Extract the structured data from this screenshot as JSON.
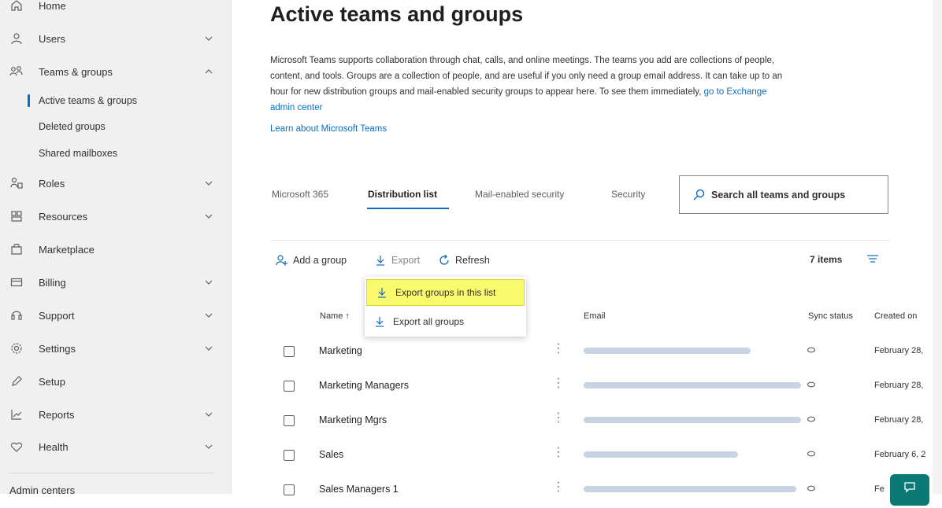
{
  "sidebar": {
    "items": [
      {
        "label": "Home",
        "icon": "home-icon",
        "chevron": false
      },
      {
        "label": "Users",
        "icon": "user-icon",
        "chevron": "down"
      },
      {
        "label": "Teams & groups",
        "icon": "teams-groups-icon",
        "chevron": "up"
      },
      {
        "label": "Roles",
        "icon": "roles-icon",
        "chevron": "down"
      },
      {
        "label": "Resources",
        "icon": "resources-icon",
        "chevron": "down"
      },
      {
        "label": "Marketplace",
        "icon": "marketplace-icon",
        "chevron": false
      },
      {
        "label": "Billing",
        "icon": "billing-icon",
        "chevron": "down"
      },
      {
        "label": "Support",
        "icon": "support-icon",
        "chevron": "down"
      },
      {
        "label": "Settings",
        "icon": "settings-icon",
        "chevron": "down"
      },
      {
        "label": "Setup",
        "icon": "setup-icon",
        "chevron": false
      },
      {
        "label": "Reports",
        "icon": "reports-icon",
        "chevron": "down"
      },
      {
        "label": "Health",
        "icon": "health-icon",
        "chevron": "down"
      }
    ],
    "sub_items": [
      {
        "label": "Active teams & groups",
        "active": true
      },
      {
        "label": "Deleted groups",
        "active": false
      },
      {
        "label": "Shared mailboxes",
        "active": false
      }
    ],
    "footer_label": "Admin centers"
  },
  "main": {
    "title": "Active teams and groups",
    "description": "Microsoft Teams supports collaboration through chat, calls, and online meetings. The teams you add are collections of people, content, and tools. Groups are a collection of people, and are useful if you only need a group email address. It can take up to an hour for new distribution groups and mail-enabled security groups to appear here. To see them immediately, ",
    "description_link": "go to Exchange admin center",
    "learn_link": "Learn about Microsoft Teams",
    "tabs": [
      "Microsoft 365",
      "Distribution list",
      "Mail-enabled security",
      "Security"
    ],
    "selected_tab": "Distribution list",
    "search_placeholder": "Search all teams and groups",
    "toolbar": {
      "add": "Add a group",
      "export": "Export",
      "refresh": "Refresh",
      "items_count": "7 items"
    },
    "export_menu": {
      "items": [
        "Export groups in this list",
        "Export all groups"
      ],
      "highlighted": "Export groups in this list"
    },
    "table": {
      "columns": {
        "name": "Name ↑",
        "email": "Email",
        "sync": "Sync status",
        "created": "Created on"
      },
      "rows": [
        {
          "name": "Marketing",
          "created": "February 28,"
        },
        {
          "name": "Marketing Managers",
          "created": "February 28,"
        },
        {
          "name": "Marketing Mgrs",
          "created": "February 28,"
        },
        {
          "name": "Sales",
          "created": "February 6, 2"
        },
        {
          "name": "Sales Managers 1",
          "created": "Fe"
        }
      ]
    }
  },
  "colors": {
    "accent": "#0f6cbd",
    "highlight": "#fafa6e",
    "fab": "#0b7a75"
  }
}
